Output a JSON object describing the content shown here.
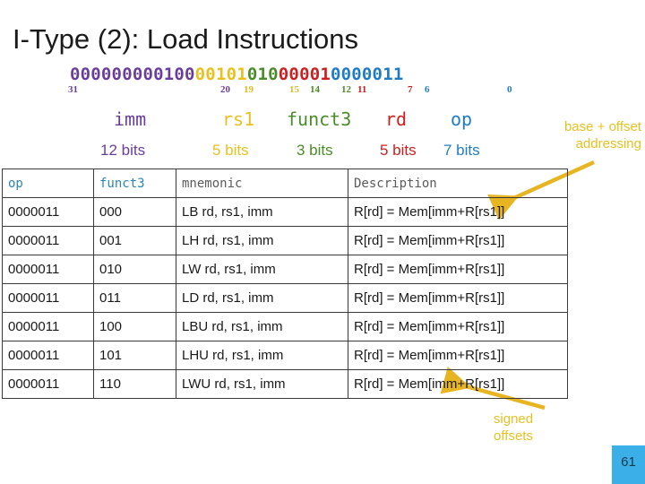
{
  "slide": {
    "title": "I-Type (2): Load Instructions",
    "page_number": "61"
  },
  "colors": {
    "imm": "#6b3d9a",
    "rs1": "#e8c120",
    "funct3": "#4a8c28",
    "rd": "#cc1f1f",
    "op": "#1f7cc4",
    "header_blue": "#2e84b5",
    "header_gray": "#5a5a5a",
    "arrow": "#e8b522",
    "page_box": "#3bb0e8",
    "text": "#1a1a1a"
  },
  "encoding": {
    "bits": {
      "imm": "000000000100",
      "rs1": "00101",
      "funct3": "010",
      "rd": "00001",
      "op": "0000011"
    },
    "indices": {
      "imm_hi": "31",
      "imm_lo": "20",
      "rs1_hi": "19",
      "rs1_lo": "15",
      "funct3_hi": "14",
      "funct3_lo": "12",
      "rd_hi": "11",
      "rd_lo": "7",
      "op_hi": "6",
      "op_lo": "0"
    },
    "field_names": {
      "imm": "imm",
      "rs1": "rs1",
      "funct3": "funct3",
      "rd": "rd",
      "op": "op"
    },
    "field_widths": {
      "imm": "12 bits",
      "rs1": "5 bits",
      "funct3": "3 bits",
      "rd": "5 bits",
      "op": "7 bits"
    }
  },
  "annotations": {
    "base_offset": "base + offset\naddressing",
    "signed_offsets": "signed\noffsets"
  },
  "table": {
    "headers": [
      "op",
      "funct3",
      "mnemonic",
      "Description"
    ],
    "rows": [
      [
        "0000011",
        "000",
        "LB rd, rs1, imm",
        "R[rd] = Mem[imm+R[rs1]]"
      ],
      [
        "0000011",
        "001",
        "LH rd, rs1, imm",
        "R[rd] = Mem[imm+R[rs1]]"
      ],
      [
        "0000011",
        "010",
        "LW rd, rs1, imm",
        "R[rd] = Mem[imm+R[rs1]]"
      ],
      [
        "0000011",
        "011",
        "LD rd, rs1, imm",
        "R[rd] = Mem[imm+R[rs1]]"
      ],
      [
        "0000011",
        "100",
        "LBU rd, rs1, imm",
        "R[rd] = Mem[imm+R[rs1]]"
      ],
      [
        "0000011",
        "101",
        "LHU rd, rs1, imm",
        "R[rd] = Mem[imm+R[rs1]]"
      ],
      [
        "0000011",
        "110",
        "LWU rd, rs1, imm",
        "R[rd] = Mem[imm+R[rs1]]"
      ]
    ]
  }
}
